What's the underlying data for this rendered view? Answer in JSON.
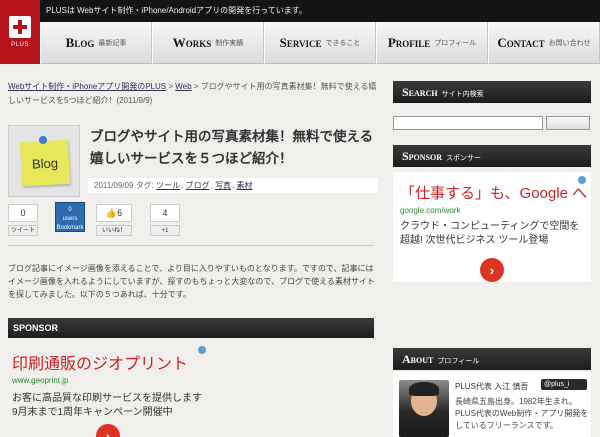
{
  "topbar": {
    "text": "PLUSは Webサイト制作・iPhone/Androidアプリの開発を行っています。"
  },
  "logo": {
    "text": "PLUS"
  },
  "nav": [
    {
      "en": "Blog",
      "jp": "最新記事"
    },
    {
      "en": "Works",
      "jp": "制作実績"
    },
    {
      "en": "Service",
      "jp": "できること"
    },
    {
      "en": "Profile",
      "jp": "プロフィール"
    },
    {
      "en": "Contact",
      "jp": "お問い合わせ"
    }
  ],
  "breadcrumb": {
    "home": "Webサイト制作・iPhoneアプリ開発のPLUS",
    "sep": " > ",
    "web": "Web",
    "current": "ブログやサイト用の写真素材集！無料で使える嬉しいサービスを5つほど紹介！(2011/9/9)"
  },
  "article": {
    "thumb_label": "Blog",
    "title": "ブログやサイト用の写真素材集！無料で使える嬉しいサービスを５つほど紹介！",
    "date": "2011/09/09",
    "tags_label": "タグ:",
    "tags": [
      "ツール",
      "ブログ",
      "写真",
      "素材"
    ],
    "intro": "ブログ記事にイメージ画像を添えることで、より目に入りやすいものとなります。ですので、記事にはイメージ画像を入れるようにしていますが、探すのもちょっと大変なので、ブログで使える素材サイトを探してみました。以下の５つあれば、十分です。"
  },
  "share": {
    "tweet_count": "0",
    "tweet_label": "ツイート",
    "hatena_count": "0",
    "hatena_label": "users",
    "hatena_sub": "Bookmark",
    "fb_count": "6",
    "fb_label": "いいね！",
    "gplus_count": "4",
    "gplus_label": "+1"
  },
  "sponsor_main": {
    "header": "SPONSOR",
    "ad_title": "印刷通販のジオプリント",
    "ad_url": "www.geoprint.jp",
    "ad_body": "お客に高品質な印刷サービスを提供します 9月末まで1周年キャンペーン開催中",
    "arrow": "›"
  },
  "sidebar": {
    "search": {
      "en": "Search",
      "jp": "サイト内検索",
      "placeholder": ""
    },
    "sponsor": {
      "en": "Sponsor",
      "jp": "スポンサー"
    },
    "ad": {
      "title": "「仕事する」も、Google へ",
      "url": "google.com/work",
      "body": "クラウド・コンピューティングで空間を超越! 次世代ビジネス ツール登場",
      "arrow": "›"
    },
    "about": {
      "en": "About",
      "jp": "プロフィール",
      "name": "PLUS代表 入江 慎吾",
      "twitter": "@plus_i",
      "body": "長崎県五島出身。1982年生まれ。\nPLUS代表のWeb制作・アプリ開発をしているフリーランスです。"
    }
  }
}
